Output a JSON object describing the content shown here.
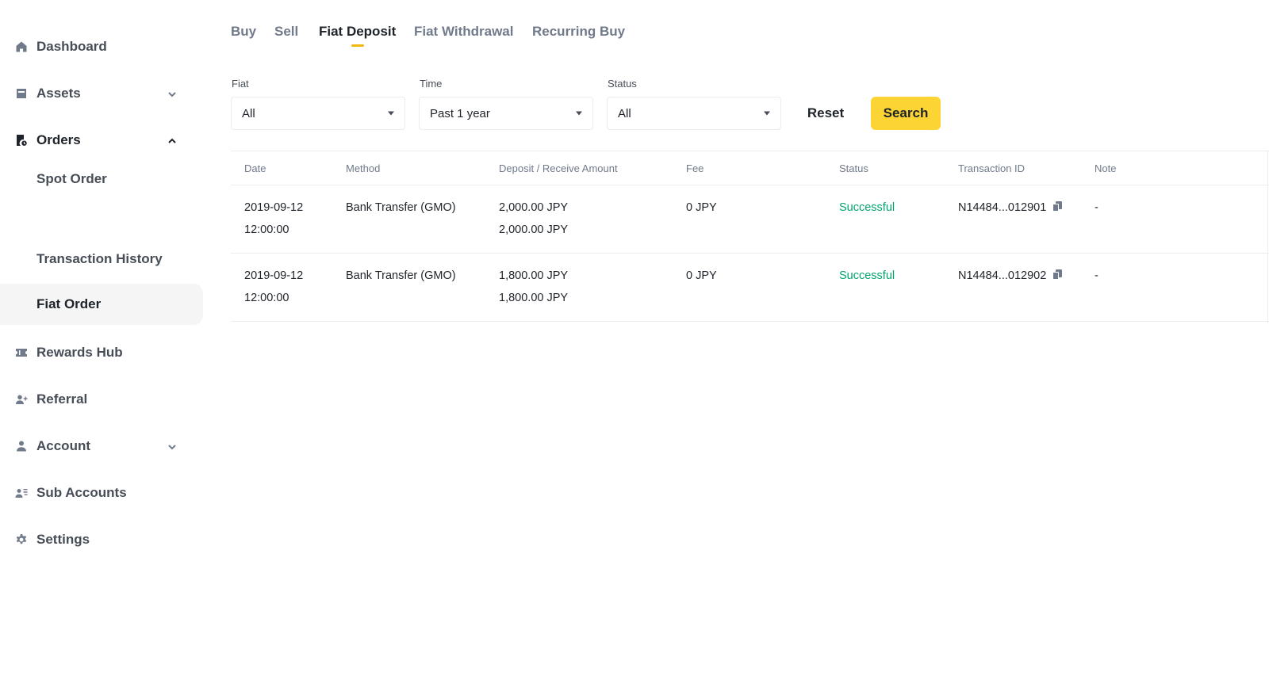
{
  "sidebar": {
    "items": [
      {
        "label": "Dashboard",
        "icon": "home-icon"
      },
      {
        "label": "Assets",
        "icon": "wallet-icon"
      },
      {
        "label": "Orders",
        "icon": "orders-icon"
      },
      {
        "label": "Spot Order"
      },
      {
        "label": "Transaction History"
      },
      {
        "label": "Fiat Order"
      },
      {
        "label": "Rewards Hub",
        "icon": "ticket-icon"
      },
      {
        "label": "Referral",
        "icon": "add-user-icon"
      },
      {
        "label": "Account",
        "icon": "user-icon"
      },
      {
        "label": "Sub Accounts",
        "icon": "sub-accounts-icon"
      },
      {
        "label": "Settings",
        "icon": "gear-icon"
      }
    ]
  },
  "tabs": [
    {
      "label": "Buy"
    },
    {
      "label": "Sell"
    },
    {
      "label": "Fiat Deposit"
    },
    {
      "label": "Fiat Withdrawal"
    },
    {
      "label": "Recurring Buy"
    }
  ],
  "filters": {
    "fiat": {
      "label": "Fiat",
      "value": "All"
    },
    "time": {
      "label": "Time",
      "value": "Past 1 year"
    },
    "status": {
      "label": "Status",
      "value": "All"
    },
    "reset_label": "Reset",
    "search_label": "Search"
  },
  "table": {
    "columns": [
      "Date",
      "Method",
      "Deposit / Receive Amount",
      "Fee",
      "Status",
      "Transaction ID",
      "Note"
    ],
    "rows": [
      {
        "date": "2019-09-12",
        "time": "12:00:00",
        "method": "Bank Transfer (GMO)",
        "deposit": "2,000.00 JPY",
        "receive": "2,000.00 JPY",
        "fee": "0 JPY",
        "status": "Successful",
        "txid": "N14484...012901",
        "note": "-"
      },
      {
        "date": "2019-09-12",
        "time": "12:00:00",
        "method": "Bank Transfer (GMO)",
        "deposit": "1,800.00 JPY",
        "receive": "1,800.00 JPY",
        "fee": "0 JPY",
        "status": "Successful",
        "txid": "N14484...012902",
        "note": "-"
      }
    ]
  },
  "colors": {
    "accent": "#fcd535",
    "success": "#03a66d",
    "muted": "#707a8a"
  }
}
